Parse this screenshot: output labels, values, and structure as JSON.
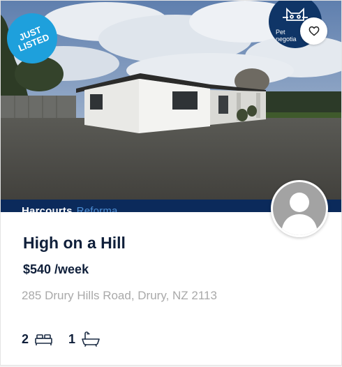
{
  "listing": {
    "badge": "JUST\nLISTED",
    "agency_logo_text": "Pet\nnegotia",
    "agency_name": "Harcourts",
    "agency_sub": "Reforma",
    "title": "High on a Hill",
    "price": "$540 /week",
    "address": "285 Drury Hills Road, Drury, NZ 2113",
    "bedrooms": "2",
    "bathrooms": "1"
  },
  "icons": {
    "favorite": "heart-outline-icon",
    "bed": "bed-icon",
    "bath": "bath-icon",
    "avatar": "person-placeholder-icon"
  },
  "colors": {
    "badge": "#1ea0dc",
    "agency_navy": "#0b2a5b",
    "title_text": "#0f1f3a",
    "address_text": "#a9a9a9"
  }
}
